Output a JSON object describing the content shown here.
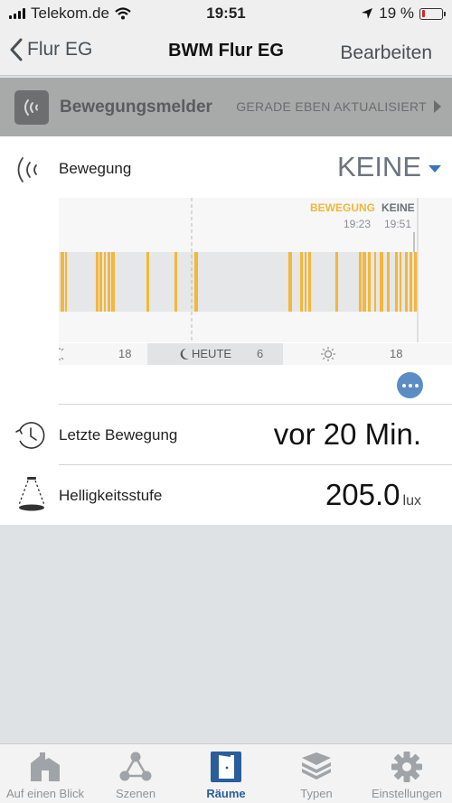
{
  "status_bar": {
    "carrier": "Telekom.de",
    "time": "19:51",
    "battery": "19 %",
    "battery_level": 0.19
  },
  "nav": {
    "back_label": "Flur EG",
    "title": "BWM Flur EG",
    "edit_label": "Bearbeiten"
  },
  "device": {
    "name": "Bewegungsmelder",
    "status": "GERADE EBEN AKTUALISIERT",
    "icon": "motion-waves-icon"
  },
  "motion": {
    "label": "Bewegung",
    "value": "KEINE",
    "more_icon": "ellipsis-icon"
  },
  "timeline": {
    "legend_motion": "BEWEGUNG",
    "legend_motion_time": "19:23",
    "legend_none": "KEINE",
    "legend_none_time": "19:51",
    "axis_18_left": "18",
    "axis_heute": "HEUTE",
    "axis_6": "6",
    "axis_18_right": "18",
    "colors": {
      "motion": "#f3b73a",
      "band": "#e5e7e8"
    }
  },
  "last_motion": {
    "label": "Letzte Bewegung",
    "value": "vor 20 Min.",
    "icon": "clock-history-icon"
  },
  "brightness": {
    "label": "Helligkeitsstufe",
    "value": "205.0",
    "unit": "lux",
    "icon": "lamp-light-icon"
  },
  "tabs": [
    {
      "label": "Auf einen Blick",
      "icon": "house-icon"
    },
    {
      "label": "Szenen",
      "icon": "scenes-icon"
    },
    {
      "label": "Räume",
      "icon": "door-icon",
      "active": true
    },
    {
      "label": "Typen",
      "icon": "layers-icon"
    },
    {
      "label": "Einstellungen",
      "icon": "gear-icon"
    }
  ],
  "colors": {
    "accent": "#3a77b9",
    "motion": "#f3b73a",
    "header_bg": "#a8a9a9",
    "battery_low": "#e02020"
  }
}
